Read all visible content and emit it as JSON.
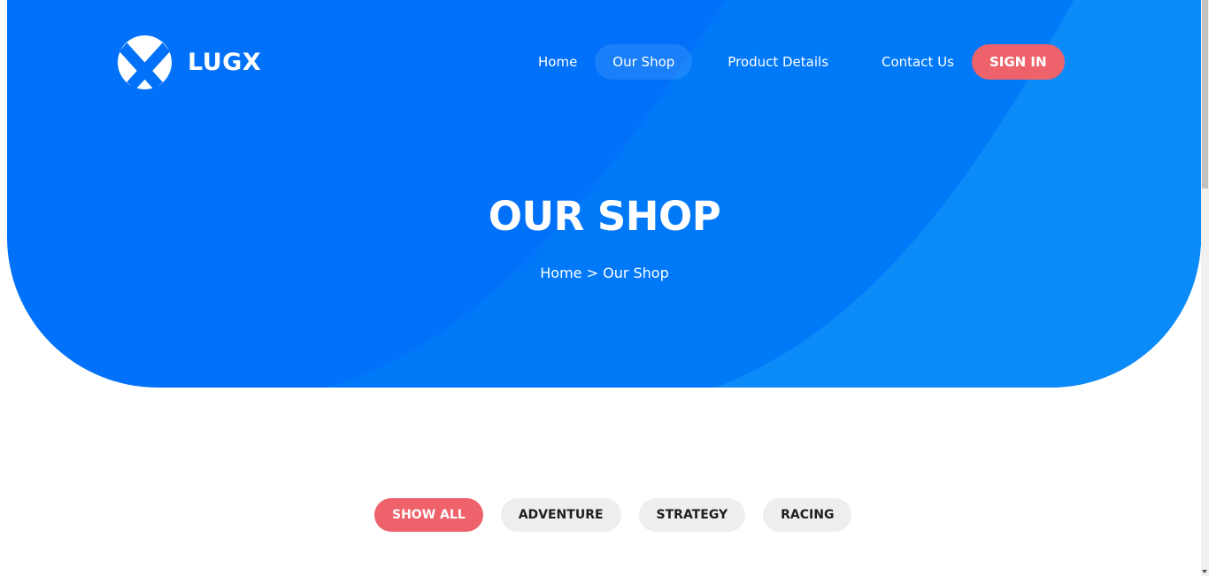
{
  "brand": {
    "name": "LUGX",
    "logo_icon": "lugx-x-logo-icon"
  },
  "nav": {
    "items": [
      {
        "label": "Home"
      },
      {
        "label": "Our Shop"
      },
      {
        "label": "Product Details"
      },
      {
        "label": "Contact Us"
      }
    ],
    "active_index": 1,
    "sign_in_label": "SIGN IN"
  },
  "hero": {
    "title": "OUR SHOP",
    "breadcrumb": {
      "home": "Home",
      "separator": ">",
      "current": "Our Shop"
    }
  },
  "filters": {
    "items": [
      {
        "label": "SHOW ALL"
      },
      {
        "label": "ADVENTURE"
      },
      {
        "label": "STRATEGY"
      },
      {
        "label": "RACING"
      }
    ],
    "active_index": 0
  },
  "colors": {
    "hero_blue": "#0071f8",
    "hero_blue_light": "#0a8cf8",
    "accent_red": "#ee626b",
    "pill_gray": "#eeeeee"
  }
}
